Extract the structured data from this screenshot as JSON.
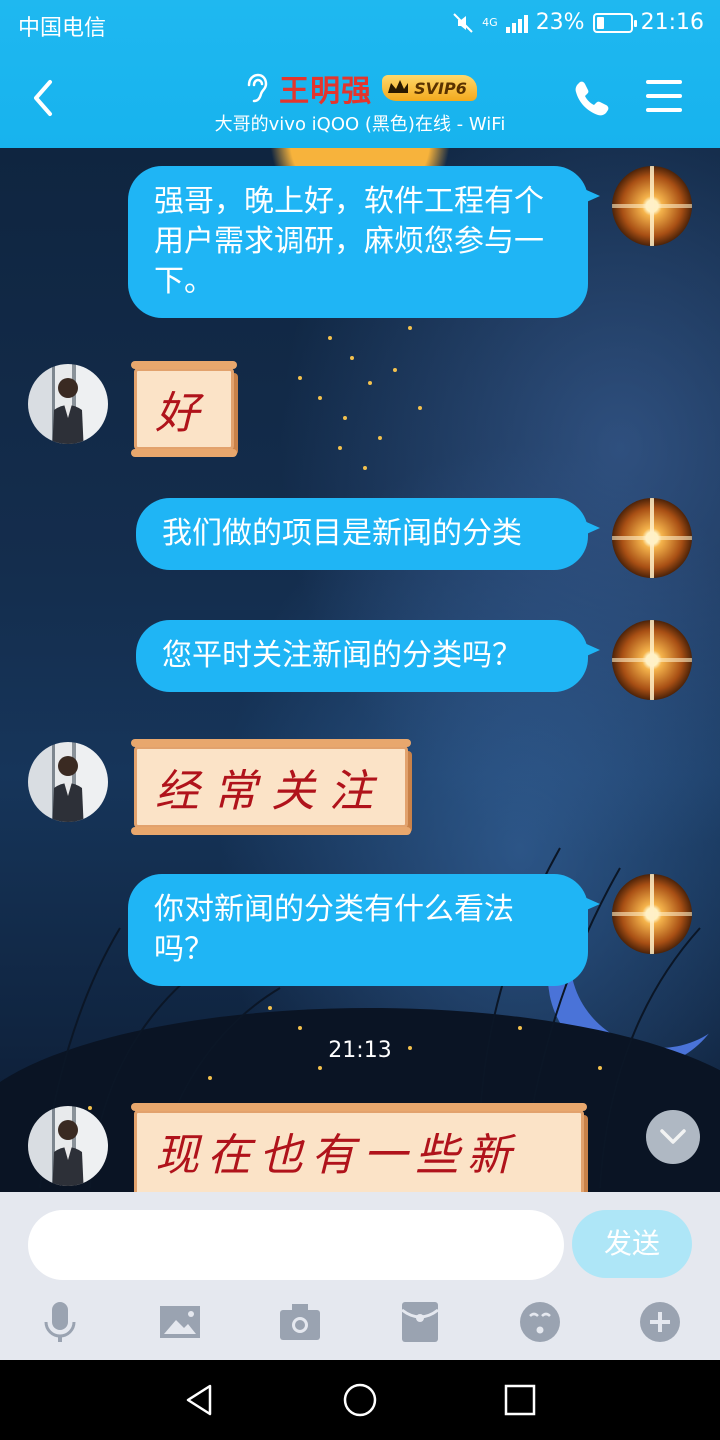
{
  "status_bar": {
    "carrier": "中国电信",
    "network": "4G",
    "battery": "23%",
    "battery_level": 0.23,
    "time": "21:16"
  },
  "header": {
    "contact_name": "王明强",
    "badge": "SVIP6",
    "subtitle": "大哥的vivo iQOO (黑色)在线 - WiFi"
  },
  "messages": [
    {
      "from": "me",
      "text": "强哥，晚上好，软件工程有个用户需求调研，麻烦您参与一下。"
    },
    {
      "from": "other",
      "text": "好"
    },
    {
      "from": "me",
      "text": "我们做的项目是新闻的分类"
    },
    {
      "from": "me",
      "text": "您平时关注新闻的分类吗？"
    },
    {
      "from": "other",
      "text": "经常关注"
    },
    {
      "from": "me",
      "text": "你对新闻的分类有什么看法吗？"
    },
    {
      "from": "other",
      "text": "现在也有一些新闻"
    }
  ],
  "timestamp": "21:13",
  "composer": {
    "placeholder": "",
    "send_label": "发送"
  },
  "toolbar": [
    "microphone-icon",
    "image-icon",
    "camera-icon",
    "red-packet-icon",
    "emoji-icon",
    "plus-icon"
  ],
  "colors": {
    "header": "#17b3ee",
    "bubble": "#1fb5f5",
    "name": "#e4352d",
    "send_disabled": "#aee6f7"
  }
}
